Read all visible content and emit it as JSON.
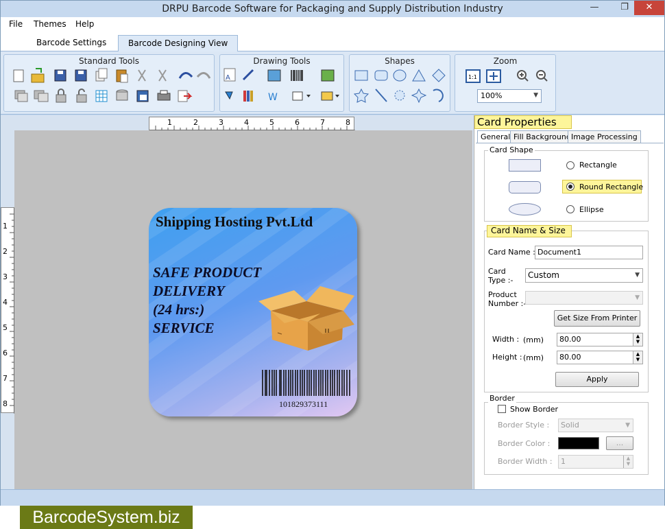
{
  "window": {
    "title": "DRPU Barcode Software for Packaging and Supply Distribution Industry"
  },
  "menu": [
    "File",
    "Themes",
    "Help"
  ],
  "tabs": [
    "Barcode Settings",
    "Barcode Designing View"
  ],
  "ribbon": {
    "groups": [
      "Standard Tools",
      "Drawing Tools",
      "Shapes",
      "Zoom"
    ],
    "zoom_value": "100%"
  },
  "rulers": {
    "h_ticks": [
      "1",
      "2",
      "3",
      "4",
      "5",
      "6",
      "7",
      "8"
    ],
    "v_ticks": [
      "1",
      "2",
      "3",
      "4",
      "5",
      "6",
      "7",
      "8"
    ]
  },
  "card": {
    "title": "Shipping Hosting Pvt.Ltd",
    "lines": [
      "SAFE PRODUCT",
      "DELIVERY",
      "(24 hrs:)",
      "SERVICE"
    ],
    "barcode_number": "101829373111"
  },
  "panel": {
    "title": "Card Properties",
    "tabs": [
      "General",
      "Fill Background",
      "Image Processing"
    ],
    "card_shape": {
      "legend": "Card Shape",
      "options": [
        "Rectangle",
        "Round Rectangle",
        "Ellipse"
      ],
      "selected": "Round Rectangle"
    },
    "name_size": {
      "legend": "Card  Name & Size",
      "card_name_label": "Card Name :",
      "card_name_value": "Document1",
      "card_type_label_1": "Card",
      "card_type_label_2": "Type :-",
      "card_type_value": "Custom",
      "product_label_1": "Product",
      "product_label_2": "Number :-",
      "get_size_button": "Get Size From Printer",
      "width_label": "Width :",
      "height_label": "Height :",
      "unit": "(mm)",
      "width_value": "80.00",
      "height_value": "80.00",
      "apply_button": "Apply"
    },
    "border": {
      "legend": "Border",
      "show_border": "Show Border",
      "style_label": "Border Style :",
      "style_value": "Solid",
      "color_label": "Border Color :",
      "color_value": "#000000",
      "dots_button": "...",
      "width_label": "Border Width :",
      "width_value": "1"
    }
  },
  "brand": "BarcodeSystem.biz"
}
